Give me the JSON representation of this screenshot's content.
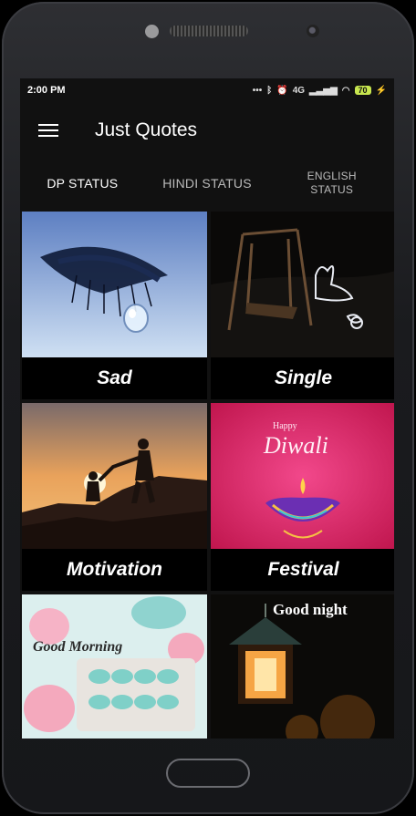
{
  "status_bar": {
    "time": "2:00 PM",
    "network": "4G",
    "battery": "70"
  },
  "app": {
    "title": "Just Quotes"
  },
  "tabs": [
    {
      "label": "DP STATUS",
      "active": true
    },
    {
      "label": "HINDI STATUS",
      "active": false
    },
    {
      "label": "ENGLISH STATUS",
      "active": false
    }
  ],
  "categories": [
    {
      "label": "Sad"
    },
    {
      "label": "Single"
    },
    {
      "label": "Motivation"
    },
    {
      "label": "Festival",
      "image_text": [
        "Happy",
        "Diwali"
      ]
    },
    {
      "label": "",
      "image_text": "Good Morning"
    },
    {
      "label": "",
      "image_text": "Good night"
    }
  ]
}
